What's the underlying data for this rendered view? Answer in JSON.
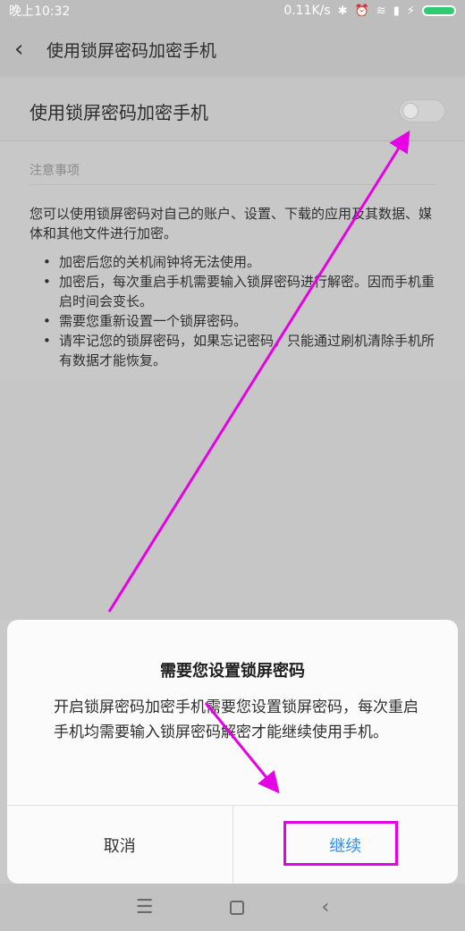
{
  "status_bar": {
    "time": "晚上10:32",
    "network_speed": "0.11K/s",
    "icons": [
      "bluetooth-icon",
      "alarm-icon",
      "wifi-icon",
      "signal-icon",
      "charging-icon",
      "battery-icon"
    ]
  },
  "header": {
    "back_icon": "chevron-left-icon",
    "title": "使用锁屏密码加密手机"
  },
  "switch_row": {
    "label": "使用锁屏密码加密手机",
    "enabled": false
  },
  "notes": {
    "heading": "注意事项",
    "intro": "您可以使用锁屏密码对自己的账户、设置、下载的应用及其数据、媒体和其他文件进行加密。",
    "items": [
      "加密后您的关机闹钟将无法使用。",
      "加密后，每次重启手机需要输入锁屏密码进行解密。因而手机重启时间会变长。",
      "需要您重新设置一个锁屏密码。",
      "请牢记您的锁屏密码，如果忘记密码，只能通过刷机清除手机所有数据才能恢复。"
    ]
  },
  "dialog": {
    "title": "需要您设置锁屏密码",
    "body": "开启锁屏密码加密手机需要您设置锁屏密码，每次重启手机均需要输入锁屏密码解密才能继续使用手机。",
    "cancel_label": "取消",
    "continue_label": "继续"
  },
  "navbar": {
    "icons": [
      "menu-icon",
      "home-icon",
      "back-icon"
    ],
    "menu_glyph": "☰",
    "back_glyph": "‹"
  },
  "colors": {
    "accent": "#2f8ef5",
    "annotation": "#e500e5",
    "toggle_off": "#d1d1d1"
  }
}
